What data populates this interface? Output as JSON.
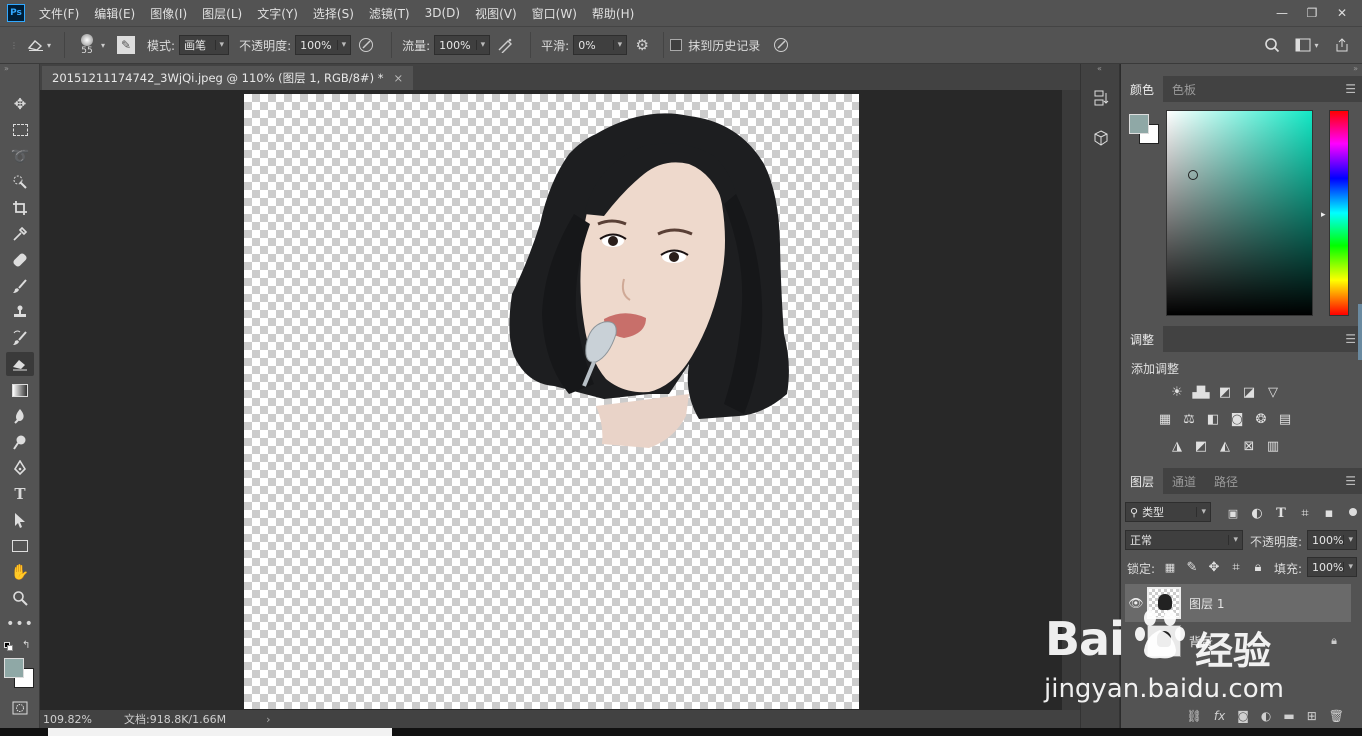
{
  "app": {
    "logo": "Ps"
  },
  "menu": [
    "文件(F)",
    "编辑(E)",
    "图像(I)",
    "图层(L)",
    "文字(Y)",
    "选择(S)",
    "滤镜(T)",
    "3D(D)",
    "视图(V)",
    "窗口(W)",
    "帮助(H)"
  ],
  "window_controls": {
    "minimize": "—",
    "restore": "❐",
    "close": "✕"
  },
  "options": {
    "brush_size": "55",
    "mode_label": "模式:",
    "mode_value": "画笔",
    "opacity_label": "不透明度:",
    "opacity_value": "100%",
    "flow_label": "流量:",
    "flow_value": "100%",
    "smooth_label": "平滑:",
    "smooth_value": "0%",
    "erase_history_label": "抹到历史记录"
  },
  "document": {
    "tab_title": "20151211174742_3WjQi.jpeg @ 110% (图层 1, RGB/8#) *",
    "close": "×"
  },
  "status": {
    "zoom": "109.82%",
    "doc_size": "文档:918.8K/1.66M",
    "arrow": "›"
  },
  "color_panel": {
    "tabs": [
      "颜色",
      "色板"
    ],
    "foreground": "#8fa8a6",
    "hue_color": "#12e8c5"
  },
  "adjust_panel": {
    "tab": "调整",
    "add_label": "添加调整"
  },
  "layers_panel": {
    "tabs": [
      "图层",
      "通道",
      "路径"
    ],
    "filter_kind": "类型",
    "blend_mode": "正常",
    "opacity_label": "不透明度:",
    "opacity_value": "100%",
    "lock_label": "锁定:",
    "fill_label": "填充:",
    "fill_value": "100%",
    "layers": [
      {
        "name": "图层 1"
      },
      {
        "name": "背景"
      }
    ],
    "fx": "fx"
  },
  "watermark": {
    "brand": "Bai",
    "brand2": "经验",
    "url": "jingyan.baidu.com"
  },
  "colors": {
    "ui": "#535353",
    "dark": "#424242",
    "ps_blue": "#31a8ff"
  }
}
